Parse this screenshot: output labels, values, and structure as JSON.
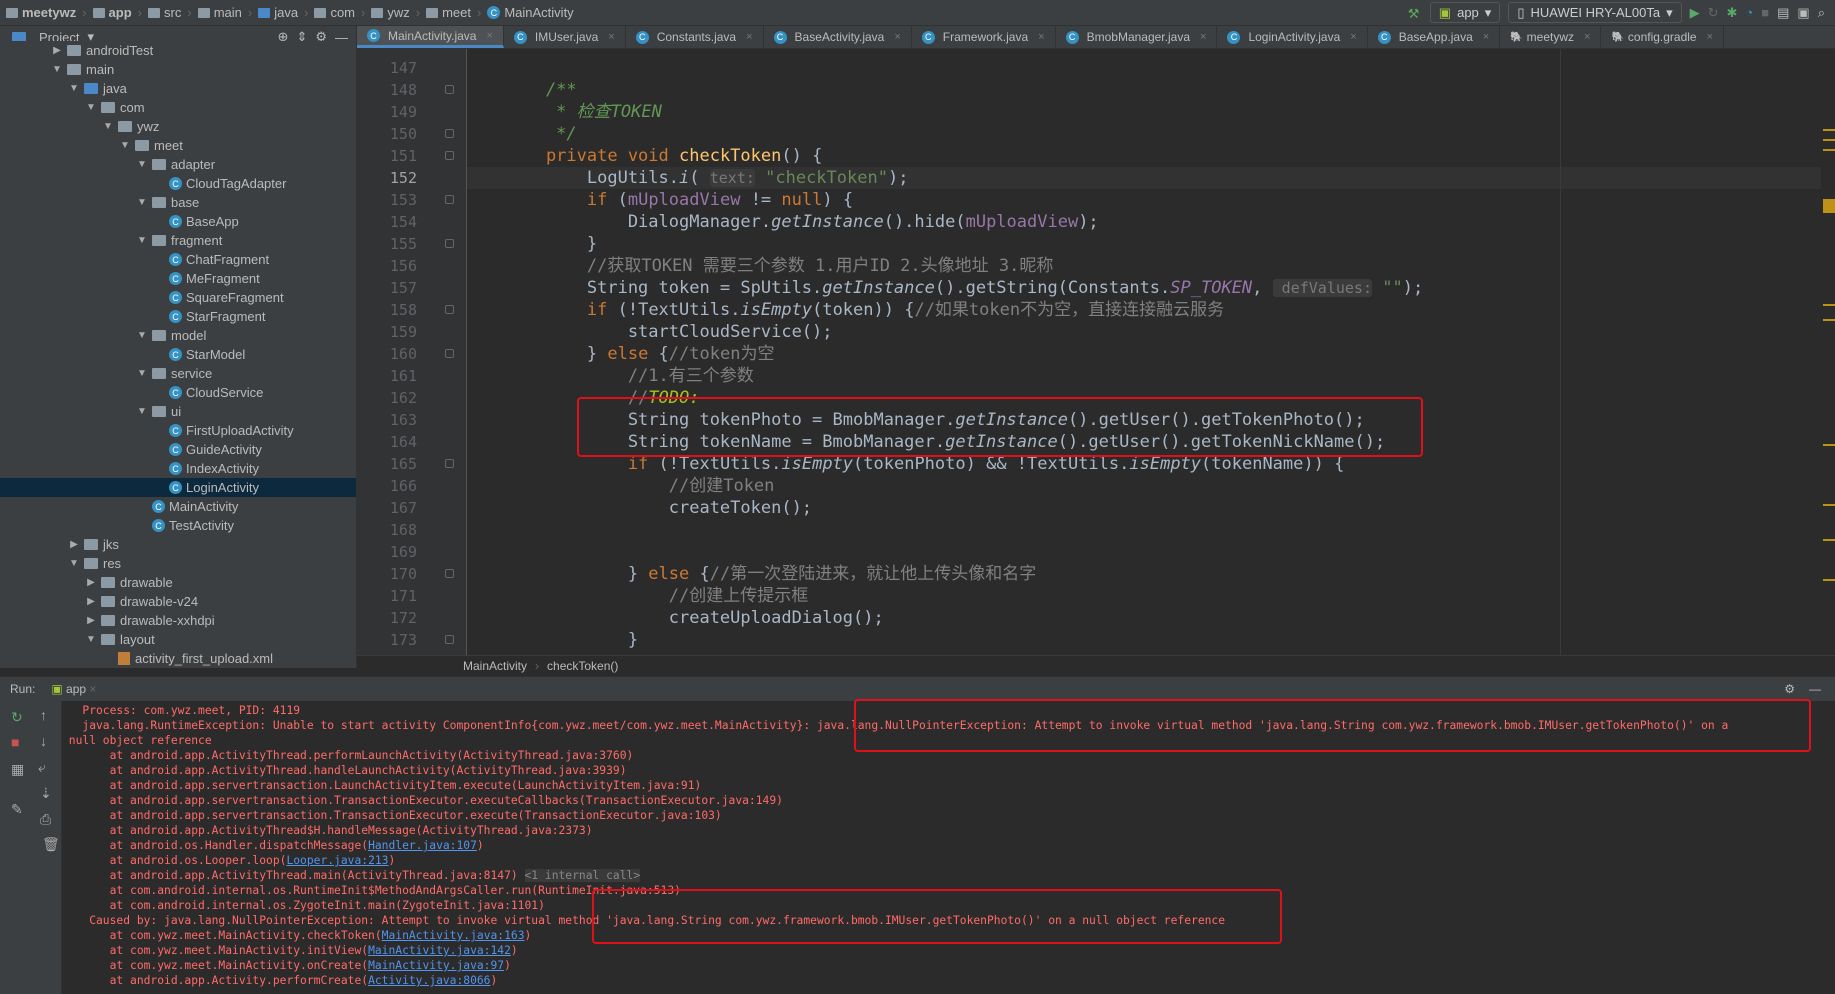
{
  "nav": {
    "crumbs": [
      "meetywz",
      "app",
      "src",
      "main",
      "java",
      "com",
      "ywz",
      "meet",
      "MainActivity"
    ],
    "run_config": "app",
    "device": "HUAWEI HRY-AL00Ta"
  },
  "project_header": "Project",
  "tabs": [
    {
      "label": "MainActivity.java",
      "active": true
    },
    {
      "label": "IMUser.java"
    },
    {
      "label": "Constants.java"
    },
    {
      "label": "BaseActivity.java"
    },
    {
      "label": "Framework.java"
    },
    {
      "label": "BmobManager.java"
    },
    {
      "label": "LoginActivity.java"
    },
    {
      "label": "BaseApp.java"
    },
    {
      "label": "meetywz"
    },
    {
      "label": "config.gradle"
    }
  ],
  "tree": [
    {
      "label": "androidTest",
      "depth": 3,
      "arrow": "▶",
      "icon": "folder"
    },
    {
      "label": "main",
      "depth": 3,
      "arrow": "▼",
      "icon": "folder"
    },
    {
      "label": "java",
      "depth": 4,
      "arrow": "▼",
      "icon": "folder-blue"
    },
    {
      "label": "com",
      "depth": 5,
      "arrow": "▼",
      "icon": "folder"
    },
    {
      "label": "ywz",
      "depth": 6,
      "arrow": "▼",
      "icon": "folder"
    },
    {
      "label": "meet",
      "depth": 7,
      "arrow": "▼",
      "icon": "folder"
    },
    {
      "label": "adapter",
      "depth": 8,
      "arrow": "▼",
      "icon": "folder"
    },
    {
      "label": "CloudTagAdapter",
      "depth": 9,
      "icon": "class"
    },
    {
      "label": "base",
      "depth": 8,
      "arrow": "▼",
      "icon": "folder"
    },
    {
      "label": "BaseApp",
      "depth": 9,
      "icon": "class"
    },
    {
      "label": "fragment",
      "depth": 8,
      "arrow": "▼",
      "icon": "folder"
    },
    {
      "label": "ChatFragment",
      "depth": 9,
      "icon": "class"
    },
    {
      "label": "MeFragment",
      "depth": 9,
      "icon": "class"
    },
    {
      "label": "SquareFragment",
      "depth": 9,
      "icon": "class"
    },
    {
      "label": "StarFragment",
      "depth": 9,
      "icon": "class"
    },
    {
      "label": "model",
      "depth": 8,
      "arrow": "▼",
      "icon": "folder"
    },
    {
      "label": "StarModel",
      "depth": 9,
      "icon": "class"
    },
    {
      "label": "service",
      "depth": 8,
      "arrow": "▼",
      "icon": "folder"
    },
    {
      "label": "CloudService",
      "depth": 9,
      "icon": "class"
    },
    {
      "label": "ui",
      "depth": 8,
      "arrow": "▼",
      "icon": "folder"
    },
    {
      "label": "FirstUploadActivity",
      "depth": 9,
      "icon": "class"
    },
    {
      "label": "GuideActivity",
      "depth": 9,
      "icon": "class"
    },
    {
      "label": "IndexActivity",
      "depth": 9,
      "icon": "class"
    },
    {
      "label": "LoginActivity",
      "depth": 9,
      "icon": "class",
      "selected": true
    },
    {
      "label": "MainActivity",
      "depth": 8,
      "icon": "class"
    },
    {
      "label": "TestActivity",
      "depth": 8,
      "icon": "class"
    },
    {
      "label": "jks",
      "depth": 4,
      "arrow": "▶",
      "icon": "folder"
    },
    {
      "label": "res",
      "depth": 4,
      "arrow": "▼",
      "icon": "folder"
    },
    {
      "label": "drawable",
      "depth": 5,
      "arrow": "▶",
      "icon": "folder"
    },
    {
      "label": "drawable-v24",
      "depth": 5,
      "arrow": "▶",
      "icon": "folder"
    },
    {
      "label": "drawable-xxhdpi",
      "depth": 5,
      "arrow": "▶",
      "icon": "folder"
    },
    {
      "label": "layout",
      "depth": 5,
      "arrow": "▼",
      "icon": "folder"
    },
    {
      "label": "activity_first_upload.xml",
      "depth": 6,
      "icon": "xml"
    }
  ],
  "editor": {
    "current_line": 152,
    "lines": [
      {
        "n": 147,
        "s": []
      },
      {
        "n": 148,
        "s": [
          [
            "    /**",
            "doc"
          ]
        ]
      },
      {
        "n": 149,
        "s": [
          [
            "     * 检查TOKEN",
            "doc"
          ]
        ]
      },
      {
        "n": 150,
        "s": [
          [
            "     */",
            "doc"
          ]
        ]
      },
      {
        "n": 151,
        "s": [
          [
            "    private void ",
            "kw"
          ],
          [
            "checkToken",
            "fn"
          ],
          [
            "() {",
            ""
          ]
        ]
      },
      {
        "n": 152,
        "s": [
          [
            "        LogUtils.",
            ""
          ],
          [
            "i",
            "it"
          ],
          [
            "( ",
            ""
          ],
          [
            "text:",
            "hint"
          ],
          [
            " \"checkToken\"",
            "st"
          ],
          [
            ");",
            ""
          ]
        ]
      },
      {
        "n": 153,
        "s": [
          [
            "        ",
            ""
          ],
          [
            "if ",
            "kw"
          ],
          [
            "(",
            ""
          ],
          [
            "mUploadView",
            "fld"
          ],
          [
            " != ",
            ""
          ],
          [
            "null",
            "kw"
          ],
          [
            ") {",
            ""
          ]
        ]
      },
      {
        "n": 154,
        "s": [
          [
            "            DialogManager.",
            ""
          ],
          [
            "getInstance",
            "it"
          ],
          [
            "().hide(",
            ""
          ],
          [
            "mUploadView",
            "fld"
          ],
          [
            ");",
            ""
          ]
        ]
      },
      {
        "n": 155,
        "s": [
          [
            "        }",
            ""
          ]
        ]
      },
      {
        "n": 156,
        "s": [
          [
            "        //获取TOKEN 需要三个参数 1.用户ID 2.头像地址 3.昵称",
            "cm"
          ]
        ]
      },
      {
        "n": 157,
        "s": [
          [
            "        String token = SpUtils.",
            ""
          ],
          [
            "getInstance",
            "it"
          ],
          [
            "().getString(Constants.",
            ""
          ],
          [
            "SP_TOKEN",
            "fldi"
          ],
          [
            ", ",
            ""
          ],
          [
            " defValues:",
            "hint"
          ],
          [
            " \"\"",
            "st"
          ],
          [
            ");",
            ""
          ]
        ]
      },
      {
        "n": 158,
        "s": [
          [
            "        ",
            ""
          ],
          [
            "if ",
            "kw"
          ],
          [
            "(!TextUtils.",
            ""
          ],
          [
            "isEmpty",
            "it"
          ],
          [
            "(token)) {",
            ""
          ],
          [
            "//如果token不为空，直接连接融云服务",
            "cm"
          ]
        ]
      },
      {
        "n": 159,
        "s": [
          [
            "            startCloudService();",
            ""
          ]
        ]
      },
      {
        "n": 160,
        "s": [
          [
            "        } ",
            ""
          ],
          [
            "else ",
            "kw"
          ],
          [
            "{",
            ""
          ],
          [
            "//token为空",
            "cm"
          ]
        ]
      },
      {
        "n": 161,
        "s": [
          [
            "            //1.有三个参数",
            "cm"
          ]
        ]
      },
      {
        "n": 162,
        "s": [
          [
            "            //",
            "cm"
          ],
          [
            "TODO:",
            "todo"
          ]
        ]
      },
      {
        "n": 163,
        "s": [
          [
            "            String tokenPhoto = BmobManager.",
            ""
          ],
          [
            "getInstance",
            "it"
          ],
          [
            "().getUser().getTokenPhoto();",
            ""
          ]
        ]
      },
      {
        "n": 164,
        "s": [
          [
            "            String tokenName = BmobManager.",
            ""
          ],
          [
            "getInstance",
            "it"
          ],
          [
            "().getUser().getTokenNickName();",
            ""
          ]
        ]
      },
      {
        "n": 165,
        "s": [
          [
            "            ",
            ""
          ],
          [
            "if ",
            "kw"
          ],
          [
            "(!TextUtils.",
            ""
          ],
          [
            "isEmpty",
            "it"
          ],
          [
            "(tokenPhoto) && !TextUtils.",
            ""
          ],
          [
            "isEmpty",
            "it"
          ],
          [
            "(tokenName)) {",
            ""
          ]
        ]
      },
      {
        "n": 166,
        "s": [
          [
            "                //创建Token",
            "cm"
          ]
        ]
      },
      {
        "n": 167,
        "s": [
          [
            "                createToken();",
            ""
          ]
        ]
      },
      {
        "n": 168,
        "s": []
      },
      {
        "n": 169,
        "s": []
      },
      {
        "n": 170,
        "s": [
          [
            "            } ",
            ""
          ],
          [
            "else ",
            "kw"
          ],
          [
            "{",
            ""
          ],
          [
            "//第一次登陆进来，就让他上传头像和名字",
            "cm"
          ]
        ]
      },
      {
        "n": 171,
        "s": [
          [
            "                //创建上传提示框",
            "cm"
          ]
        ]
      },
      {
        "n": 172,
        "s": [
          [
            "                createUploadDialog();",
            ""
          ]
        ]
      },
      {
        "n": 173,
        "s": [
          [
            "            }",
            ""
          ]
        ]
      }
    ]
  },
  "breadcrumb": [
    "MainActivity",
    "checkToken()"
  ],
  "run": {
    "label": "Run:",
    "tab": "app",
    "console": [
      {
        "t": "   Process: com.ywz.meet, PID: 4119"
      },
      {
        "t": "   java.lang.RuntimeException: Unable to start activity ComponentInfo{com.ywz.meet/com.ywz.meet.MainActivity}: java.lang.NullPointerException: Attempt to invoke virtual method 'java.lang.String com.ywz.framework.bmob.IMUser.getTokenPhoto()' on a"
      },
      {
        "t": " null object reference"
      },
      {
        "t": "       at android.app.ActivityThread.performLaunchActivity(ActivityThread.java:3760)"
      },
      {
        "t": "       at android.app.ActivityThread.handleLaunchActivity(ActivityThread.java:3939)"
      },
      {
        "t": "       at android.app.servertransaction.LaunchActivityItem.execute(LaunchActivityItem.java:91)"
      },
      {
        "t": "       at android.app.servertransaction.TransactionExecutor.executeCallbacks(TransactionExecutor.java:149)"
      },
      {
        "t": "       at android.app.servertransaction.TransactionExecutor.execute(TransactionExecutor.java:103)"
      },
      {
        "t": "       at android.app.ActivityThread$H.handleMessage(ActivityThread.java:2373)"
      },
      {
        "t": "       at android.os.Handler.dispatchMessage(",
        "link": "Handler.java:107",
        "tail": ")"
      },
      {
        "t": "       at android.os.Looper.loop(",
        "link": "Looper.java:213",
        "tail": ")"
      },
      {
        "t": "       at android.app.ActivityThread.main(ActivityThread.java:8147) ",
        "int": "<1 internal call>"
      },
      {
        "t": "       at com.android.internal.os.RuntimeInit$MethodAndArgsCaller.run(RuntimeInit.java:513)"
      },
      {
        "t": "       at com.android.internal.os.ZygoteInit.main(ZygoteInit.java:1101)"
      },
      {
        "t": "    Caused by: java.lang.NullPointerException: Attempt to invoke virtual method 'java.lang.String com.ywz.framework.bmob.IMUser.getTokenPhoto()' on a null object reference"
      },
      {
        "t": "       at com.ywz.meet.MainActivity.checkToken(",
        "link": "MainActivity.java:163",
        "tail": ")"
      },
      {
        "t": "       at com.ywz.meet.MainActivity.initView(",
        "link": "MainActivity.java:142",
        "tail": ")"
      },
      {
        "t": "       at com.ywz.meet.MainActivity.onCreate(",
        "link": "MainActivity.java:97",
        "tail": ")"
      },
      {
        "t": "       at android.app.Activity.performCreate(",
        "link": "Activity.java:8066",
        "tail": ")"
      }
    ]
  }
}
